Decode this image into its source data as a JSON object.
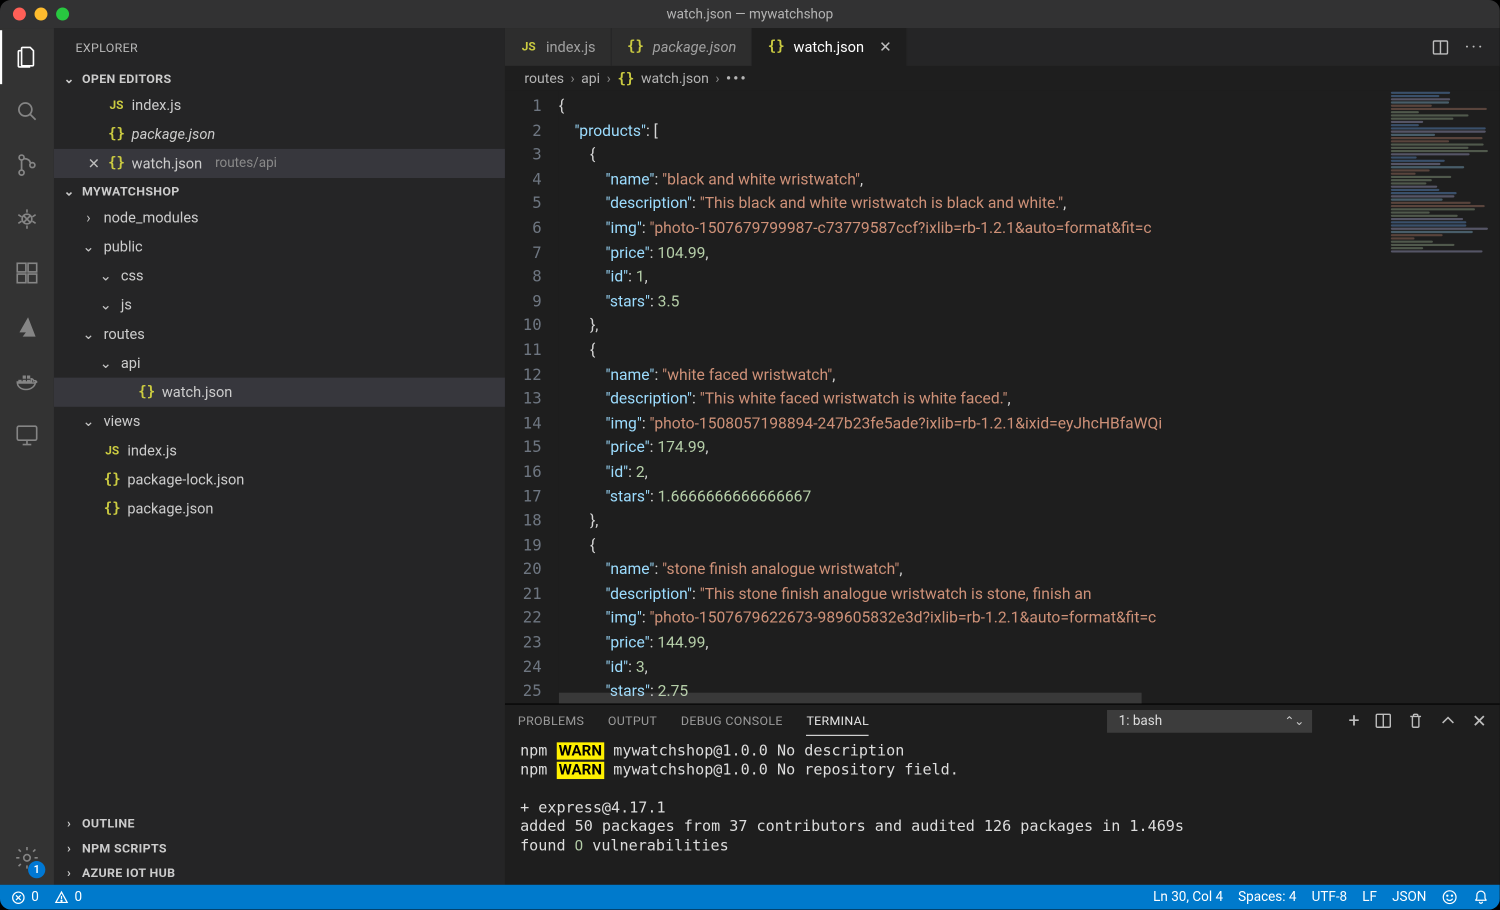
{
  "window": {
    "title": "watch.json — mywatchshop"
  },
  "activity_bar": {
    "items": [
      {
        "name": "explorer",
        "active": true
      },
      {
        "name": "search"
      },
      {
        "name": "source-control"
      },
      {
        "name": "run-debug"
      },
      {
        "name": "extensions"
      },
      {
        "name": "azure"
      },
      {
        "name": "docker"
      },
      {
        "name": "remote-explorer"
      }
    ],
    "bottom": {
      "name": "settings",
      "badge": "1"
    }
  },
  "sidebar": {
    "title": "EXPLORER",
    "sections": {
      "open_editors": {
        "label": "OPEN EDITORS",
        "items": [
          {
            "icon": "js",
            "name": "index.js",
            "modified": false,
            "active": false
          },
          {
            "icon": "json",
            "name": "package.json",
            "modified": false,
            "active": false,
            "italic": true
          },
          {
            "icon": "json",
            "name": "watch.json",
            "meta": "routes/api",
            "modified": false,
            "active": true
          }
        ]
      },
      "workspace": {
        "label": "MYWATCHSHOP",
        "tree": [
          {
            "type": "folder",
            "name": "node_modules",
            "open": false,
            "depth": 0
          },
          {
            "type": "folder",
            "name": "public",
            "open": true,
            "depth": 0
          },
          {
            "type": "folder",
            "name": "css",
            "open": true,
            "depth": 1
          },
          {
            "type": "folder",
            "name": "js",
            "open": true,
            "depth": 1
          },
          {
            "type": "folder",
            "name": "routes",
            "open": true,
            "depth": 0
          },
          {
            "type": "folder",
            "name": "api",
            "open": true,
            "depth": 1
          },
          {
            "type": "file",
            "icon": "json",
            "name": "watch.json",
            "depth": 2,
            "selected": true
          },
          {
            "type": "folder",
            "name": "views",
            "open": true,
            "depth": 0
          },
          {
            "type": "file",
            "icon": "js",
            "name": "index.js",
            "depth": 0
          },
          {
            "type": "file",
            "icon": "json",
            "name": "package-lock.json",
            "depth": 0
          },
          {
            "type": "file",
            "icon": "json",
            "name": "package.json",
            "depth": 0
          }
        ]
      },
      "collapsed": [
        {
          "label": "OUTLINE"
        },
        {
          "label": "NPM SCRIPTS"
        },
        {
          "label": "AZURE IOT HUB"
        }
      ]
    }
  },
  "editor": {
    "tabs": [
      {
        "icon": "js",
        "label": "index.js",
        "active": false
      },
      {
        "icon": "json",
        "label": "package.json",
        "italic": true,
        "active": false
      },
      {
        "icon": "json",
        "label": "watch.json",
        "active": true,
        "close": true
      }
    ],
    "breadcrumbs": [
      "routes",
      "api",
      "watch.json",
      "..."
    ],
    "line_count": 25,
    "code_lines": [
      [
        [
          "p",
          "{"
        ]
      ],
      [
        [
          "p",
          "    "
        ],
        [
          "k",
          "\"products\""
        ],
        [
          "p",
          ": ["
        ]
      ],
      [
        [
          "p",
          "        {"
        ]
      ],
      [
        [
          "p",
          "            "
        ],
        [
          "k",
          "\"name\""
        ],
        [
          "p",
          ": "
        ],
        [
          "s",
          "\"black and white wristwatch\""
        ],
        [
          "p",
          ","
        ]
      ],
      [
        [
          "p",
          "            "
        ],
        [
          "k",
          "\"description\""
        ],
        [
          "p",
          ": "
        ],
        [
          "s",
          "\"This black and white wristwatch is black and white.\""
        ],
        [
          "p",
          ","
        ]
      ],
      [
        [
          "p",
          "            "
        ],
        [
          "k",
          "\"img\""
        ],
        [
          "p",
          ": "
        ],
        [
          "s",
          "\"photo-1507679799987-c73779587ccf?ixlib=rb-1.2.1&auto=format&fit=c"
        ]
      ],
      [
        [
          "p",
          "            "
        ],
        [
          "k",
          "\"price\""
        ],
        [
          "p",
          ": "
        ],
        [
          "n",
          "104.99"
        ],
        [
          "p",
          ","
        ]
      ],
      [
        [
          "p",
          "            "
        ],
        [
          "k",
          "\"id\""
        ],
        [
          "p",
          ": "
        ],
        [
          "n",
          "1"
        ],
        [
          "p",
          ","
        ]
      ],
      [
        [
          "p",
          "            "
        ],
        [
          "k",
          "\"stars\""
        ],
        [
          "p",
          ": "
        ],
        [
          "n",
          "3.5"
        ]
      ],
      [
        [
          "p",
          "        },"
        ]
      ],
      [
        [
          "p",
          "        {"
        ]
      ],
      [
        [
          "p",
          "            "
        ],
        [
          "k",
          "\"name\""
        ],
        [
          "p",
          ": "
        ],
        [
          "s",
          "\"white faced wristwatch\""
        ],
        [
          "p",
          ","
        ]
      ],
      [
        [
          "p",
          "            "
        ],
        [
          "k",
          "\"description\""
        ],
        [
          "p",
          ": "
        ],
        [
          "s",
          "\"This white faced wristwatch is white faced.\""
        ],
        [
          "p",
          ","
        ]
      ],
      [
        [
          "p",
          "            "
        ],
        [
          "k",
          "\"img\""
        ],
        [
          "p",
          ": "
        ],
        [
          "s",
          "\"photo-1508057198894-247b23fe5ade?ixlib=rb-1.2.1&ixid=eyJhcHBfaWQi"
        ]
      ],
      [
        [
          "p",
          "            "
        ],
        [
          "k",
          "\"price\""
        ],
        [
          "p",
          ": "
        ],
        [
          "n",
          "174.99"
        ],
        [
          "p",
          ","
        ]
      ],
      [
        [
          "p",
          "            "
        ],
        [
          "k",
          "\"id\""
        ],
        [
          "p",
          ": "
        ],
        [
          "n",
          "2"
        ],
        [
          "p",
          ","
        ]
      ],
      [
        [
          "p",
          "            "
        ],
        [
          "k",
          "\"stars\""
        ],
        [
          "p",
          ": "
        ],
        [
          "n",
          "1.6666666666666667"
        ]
      ],
      [
        [
          "p",
          "        },"
        ]
      ],
      [
        [
          "p",
          "        {"
        ]
      ],
      [
        [
          "p",
          "            "
        ],
        [
          "k",
          "\"name\""
        ],
        [
          "p",
          ": "
        ],
        [
          "s",
          "\"stone finish analogue wristwatch\""
        ],
        [
          "p",
          ","
        ]
      ],
      [
        [
          "p",
          "            "
        ],
        [
          "k",
          "\"description\""
        ],
        [
          "p",
          ": "
        ],
        [
          "s",
          "\"This stone finish analogue wristwatch is stone, finish an"
        ]
      ],
      [
        [
          "p",
          "            "
        ],
        [
          "k",
          "\"img\""
        ],
        [
          "p",
          ": "
        ],
        [
          "s",
          "\"photo-1507679622673-989605832e3d?ixlib=rb-1.2.1&auto=format&fit=c"
        ]
      ],
      [
        [
          "p",
          "            "
        ],
        [
          "k",
          "\"price\""
        ],
        [
          "p",
          ": "
        ],
        [
          "n",
          "144.99"
        ],
        [
          "p",
          ","
        ]
      ],
      [
        [
          "p",
          "            "
        ],
        [
          "k",
          "\"id\""
        ],
        [
          "p",
          ": "
        ],
        [
          "n",
          "3"
        ],
        [
          "p",
          ","
        ]
      ],
      [
        [
          "p",
          "            "
        ],
        [
          "k",
          "\"stars\""
        ],
        [
          "p",
          ": "
        ],
        [
          "n",
          "2.75"
        ]
      ]
    ]
  },
  "panel": {
    "tabs": [
      "PROBLEMS",
      "OUTPUT",
      "DEBUG CONSOLE",
      "TERMINAL"
    ],
    "active_tab": "TERMINAL",
    "selector": "1: bash",
    "terminal_lines": [
      [
        [
          "t",
          "npm "
        ],
        [
          "w",
          "WARN"
        ],
        [
          "t",
          " mywatchshop@1.0.0 No description"
        ]
      ],
      [
        [
          "t",
          "npm "
        ],
        [
          "w",
          "WARN"
        ],
        [
          "t",
          " mywatchshop@1.0.0 No repository field."
        ]
      ],
      [
        [
          "t",
          ""
        ]
      ],
      [
        [
          "t",
          "+ express@4.17.1"
        ]
      ],
      [
        [
          "t",
          "added 50 packages from 37 contributors and audited 126 packages in 1.469s"
        ]
      ],
      [
        [
          "t",
          "found "
        ],
        [
          "n",
          "0"
        ],
        [
          "t",
          " vulnerabilities"
        ]
      ]
    ]
  },
  "status": {
    "errors": "0",
    "warnings": "0",
    "ln_col": "Ln 30, Col 4",
    "spaces": "Spaces: 4",
    "encoding": "UTF-8",
    "eol": "LF",
    "lang": "JSON"
  }
}
